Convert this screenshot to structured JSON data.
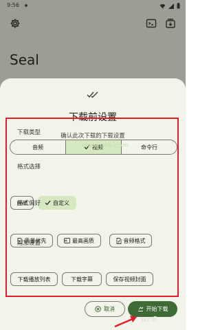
{
  "status_bar": {
    "time": "9:56"
  },
  "app": {
    "title": "Seal"
  },
  "sheet": {
    "title": "下载前设置",
    "subtitle": "确认此次下载的下载设置",
    "watermark": "www.pc6.com",
    "sections": {
      "download_type": {
        "title": "下载类型",
        "options": [
          "音频",
          "视频",
          "命令行"
        ],
        "selected": "视频"
      },
      "format_select": {
        "title": "格式选择",
        "options": [
          "自动",
          "自定义"
        ],
        "selected": "自定义"
      },
      "format_pref": {
        "title": "格式偏好",
        "options": [
          "质量优先",
          "最高画质",
          "音频格式"
        ]
      },
      "extra": {
        "title": "附加设置",
        "options": [
          "下载播放列表",
          "下载字幕",
          "保存视频封面"
        ]
      }
    },
    "actions": {
      "cancel": "取消",
      "start": "开始下载"
    }
  },
  "corner_logo": "pc6"
}
